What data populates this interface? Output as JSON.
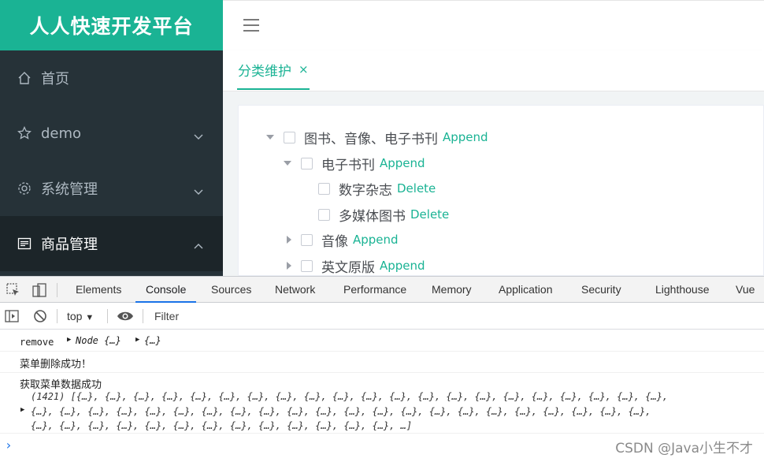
{
  "app": {
    "title": "人人快速开发平台"
  },
  "sidebar": {
    "items": [
      {
        "label": "首页",
        "icon": "home-icon"
      },
      {
        "label": "demo",
        "icon": "star-icon"
      },
      {
        "label": "系统管理",
        "icon": "gear-icon"
      },
      {
        "label": "商品管理",
        "icon": "list-icon"
      }
    ]
  },
  "tabs": {
    "active": "分类维护",
    "close": "×"
  },
  "tree": {
    "nodes": [
      {
        "label": "图书、音像、电子书刊",
        "action": "Append"
      },
      {
        "label": "电子书刊",
        "action": "Append"
      },
      {
        "label": "数字杂志",
        "action": "Delete"
      },
      {
        "label": "多媒体图书",
        "action": "Delete"
      },
      {
        "label": "音像",
        "action": "Append"
      },
      {
        "label": "英文原版",
        "action": "Append"
      }
    ]
  },
  "devtools": {
    "tabs": [
      "Elements",
      "Console",
      "Sources",
      "Network",
      "Performance",
      "Memory",
      "Application",
      "Security",
      "Lighthouse",
      "Vue"
    ],
    "context": "top",
    "filter_placeholder": "Filter",
    "logs": {
      "remove_label": "remove",
      "remove_arg1": "Node {…}",
      "remove_arg2": "{…}",
      "delete_msg": "菜单删除成功！",
      "fetch_msg": "获取菜单数据成功",
      "array_line1": "(1421) [{…}, {…}, {…}, {…}, {…}, {…}, {…}, {…}, {…}, {…}, {…}, {…}, {…}, {…}, {…}, {…}, {…}, {…}, {…}, {…}, {…},",
      "array_line2": "{…}, {…}, {…}, {…}, {…}, {…}, {…}, {…}, {…}, {…}, {…}, {…}, {…}, {…}, {…}, {…}, {…}, {…}, {…}, {…}, {…}, {…},",
      "array_line3": "{…}, {…}, {…}, {…}, {…}, {…}, {…}, {…}, {…}, {…}, {…}, {…}, {…}, …]"
    },
    "prompt": "›"
  },
  "watermark": "CSDN @Java小生不才",
  "colors": {
    "accent": "#1ab394",
    "sidebar": "#263238",
    "link": "#1a73e8"
  }
}
